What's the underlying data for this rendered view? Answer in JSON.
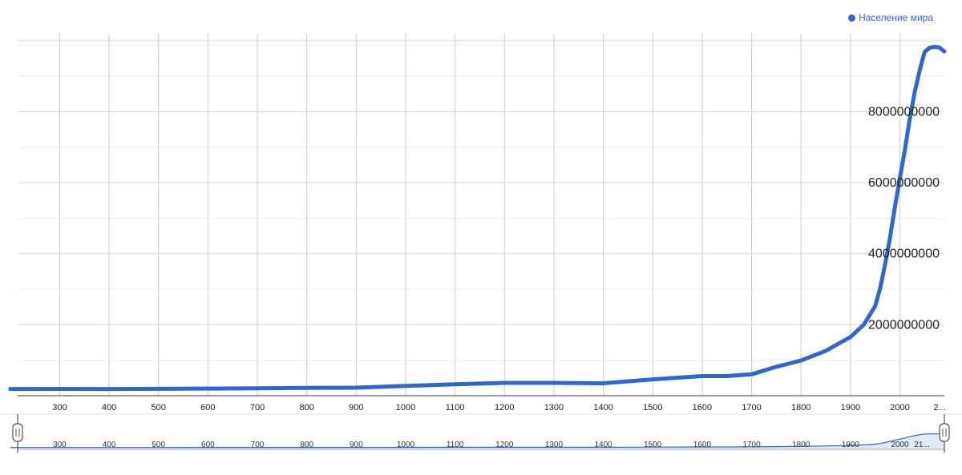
{
  "chart_data": {
    "type": "line",
    "title": "",
    "xlabel": "",
    "ylabel": "",
    "series": [
      {
        "name": "Население мира",
        "color": "#3366cc",
        "points": [
          [
            200,
            190000000
          ],
          [
            300,
            192000000
          ],
          [
            400,
            190000000
          ],
          [
            500,
            195000000
          ],
          [
            600,
            200000000
          ],
          [
            700,
            207000000
          ],
          [
            800,
            220000000
          ],
          [
            900,
            226000000
          ],
          [
            1000,
            275000000
          ],
          [
            1100,
            320000000
          ],
          [
            1200,
            360000000
          ],
          [
            1300,
            360000000
          ],
          [
            1400,
            350000000
          ],
          [
            1500,
            461000000
          ],
          [
            1600,
            554000000
          ],
          [
            1650,
            554000000
          ],
          [
            1700,
            603000000
          ],
          [
            1750,
            814000000
          ],
          [
            1800,
            990000000
          ],
          [
            1850,
            1263000000
          ],
          [
            1900,
            1654000000
          ],
          [
            1927,
            2000000000
          ],
          [
            1950,
            2525000000
          ],
          [
            1960,
            3026000000
          ],
          [
            1970,
            3691000000
          ],
          [
            1980,
            4449000000
          ],
          [
            1990,
            5320000000
          ],
          [
            2000,
            6127000000
          ],
          [
            2010,
            6916000000
          ],
          [
            2020,
            7795000000
          ],
          [
            2030,
            8548000000
          ],
          [
            2040,
            9161000000
          ],
          [
            2050,
            9680000000
          ],
          [
            2060,
            9800000000
          ],
          [
            2070,
            9830000000
          ],
          [
            2080,
            9810000000
          ],
          [
            2090,
            9700000000
          ]
        ]
      }
    ],
    "x_ticks": [
      "300",
      "400",
      "500",
      "600",
      "700",
      "800",
      "900",
      "1000",
      "1100",
      "1200",
      "1300",
      "1400",
      "1500",
      "1600",
      "1700",
      "1800",
      "1900",
      "2000",
      "2..."
    ],
    "y_ticks": [
      "2000000000",
      "4000000000",
      "6000000000",
      "8000000000"
    ],
    "xlim": [
      215,
      2090
    ],
    "ylim": [
      0,
      10200000000
    ],
    "grid": true,
    "legend_position": "top-right",
    "range_selector": {
      "x_ticks": [
        "300",
        "400",
        "500",
        "600",
        "700",
        "800",
        "900",
        "1000",
        "1100",
        "1200",
        "1300",
        "1400",
        "1500",
        "1600",
        "1700",
        "1800",
        "1900",
        "2000",
        "21..."
      ]
    }
  }
}
